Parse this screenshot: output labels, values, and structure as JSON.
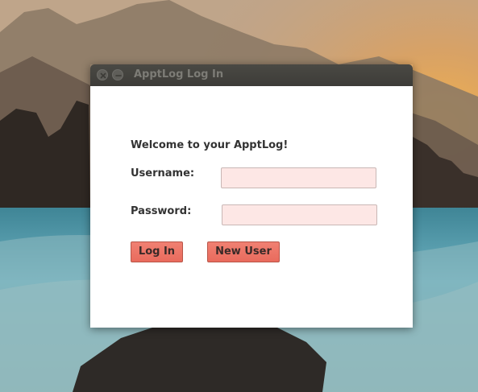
{
  "window": {
    "title": "ApptLog Log In",
    "controls": {
      "close_icon": "close-icon",
      "minimize_icon": "minimize-icon"
    }
  },
  "form": {
    "welcome": "Welcome to your ApptLog!",
    "username_label": "Username:",
    "username_value": "",
    "password_label": "Password:",
    "password_value": "",
    "login_label": "Log In",
    "new_user_label": "New User"
  },
  "colors": {
    "titlebar": "#3d3c38",
    "field_bg": "#fde7e5",
    "button_bg": "#e96b5d"
  }
}
